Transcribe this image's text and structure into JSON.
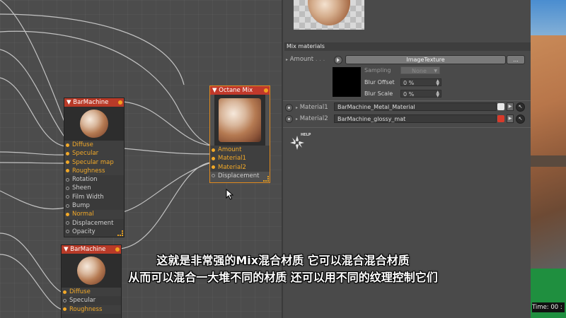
{
  "node_editor": {
    "nodes": [
      {
        "title": "BarMachine",
        "ports": [
          {
            "label": "Diffuse",
            "active": true
          },
          {
            "label": "Specular",
            "active": true
          },
          {
            "label": "Specular map",
            "active": true
          },
          {
            "label": "Roughness",
            "active": true
          },
          {
            "label": "Rotation",
            "active": false
          },
          {
            "label": "Sheen",
            "active": false
          },
          {
            "label": "Film Width",
            "active": false
          },
          {
            "label": "Bump",
            "active": false
          },
          {
            "label": "Normal",
            "active": true
          },
          {
            "label": "Displacement",
            "active": false
          },
          {
            "label": "Opacity",
            "active": false
          }
        ]
      },
      {
        "title": "Octane Mix",
        "ports": [
          {
            "label": "Amount",
            "active": true
          },
          {
            "label": "Material1",
            "active": true
          },
          {
            "label": "Material2",
            "active": true
          },
          {
            "label": "Displacement",
            "active": false
          }
        ]
      },
      {
        "title": "BarMachine",
        "ports": [
          {
            "label": "Diffuse",
            "active": true
          },
          {
            "label": "Specular",
            "active": false
          },
          {
            "label": "Roughness",
            "active": true
          }
        ]
      }
    ]
  },
  "attributes": {
    "section_title": "Mix materials",
    "amount_label": "Amount",
    "amount_dots": ". . .",
    "image_texture_button": "ImageTexture",
    "more_button": "...",
    "sampling_label": "Sampling",
    "sampling_value": "None",
    "blur_offset_label": "Blur Offset",
    "blur_offset_value": "0 %",
    "blur_scale_label": "Blur Scale",
    "blur_scale_value": "0 %",
    "material1_label": "Material1",
    "material1_value": "BarMachine_Metal_Material",
    "material1_swatch_color": "#e8e8e8",
    "material2_label": "Material2",
    "material2_value": "BarMachine_glossy_mat",
    "material2_swatch_color": "#d83a2a",
    "help_label": "HELP"
  },
  "viewport": {
    "time_label": "Time: 00 :"
  },
  "subtitles": {
    "line1": "这就是非常强的Mix混合材质 它可以混合混合材质",
    "line2": "从而可以混合一大堆不同的材质 还可以用不同的纹理控制它们"
  },
  "colors": {
    "node_header": "#b83a28",
    "active_port": "#f2a928",
    "selection_border": "#e08a1e"
  }
}
